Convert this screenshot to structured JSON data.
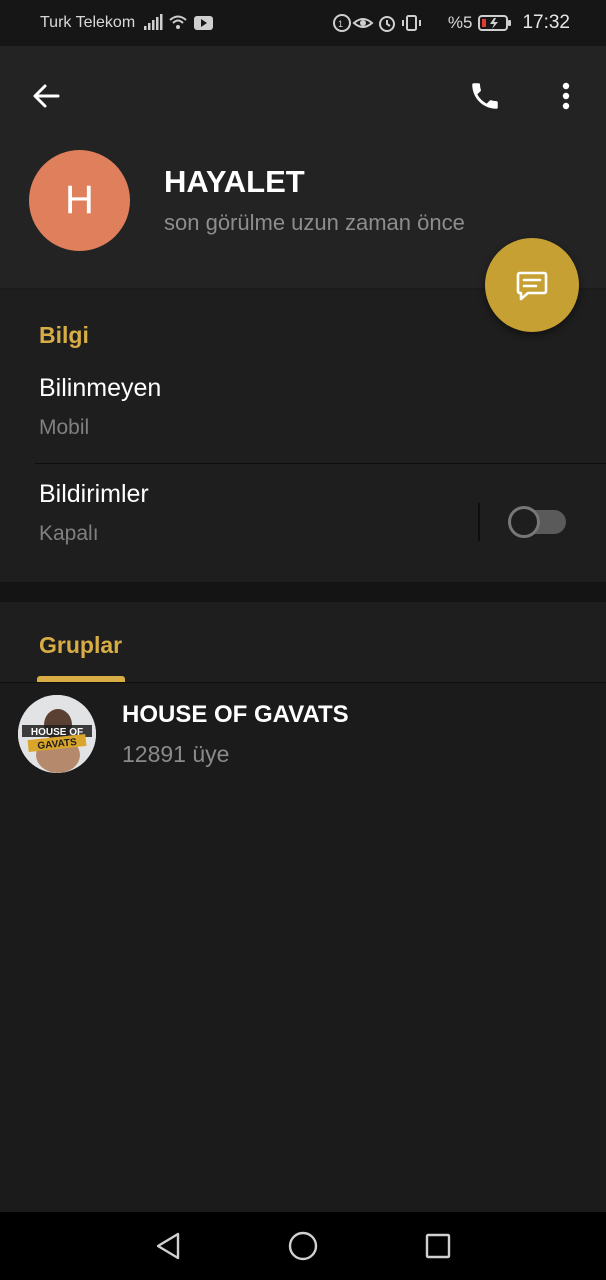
{
  "status_bar": {
    "carrier": "Turk Telekom",
    "battery_percent": "%5",
    "time": "17:32"
  },
  "toolbar": {
    "back_icon": "arrow-left-icon",
    "call_icon": "phone-icon",
    "menu_icon": "more-vertical-icon"
  },
  "contact": {
    "avatar_letter": "H",
    "avatar_color": "#e07f5b",
    "name": "HAYALET",
    "last_seen": "son görülme uzun zaman önce"
  },
  "fab": {
    "icon": "message-icon",
    "color": "#c6a033"
  },
  "info_section": {
    "title": "Bilgi",
    "phone_title": "Bilinmeyen",
    "phone_sub": "Mobil",
    "notifications_title": "Bildirimler",
    "notifications_sub": "Kapalı",
    "notifications_enabled": false
  },
  "groups_section": {
    "title": "Gruplar",
    "items": [
      {
        "name": "HOUSE OF GAVATS",
        "members": "12891 üye",
        "avatar_text": [
          "HOUSE OF",
          "GAVATS"
        ]
      }
    ]
  },
  "nav_bar": {
    "back_icon": "triangle-back-icon",
    "home_icon": "circle-home-icon",
    "recents_icon": "square-recents-icon"
  },
  "accent_color": "#d8ad46"
}
